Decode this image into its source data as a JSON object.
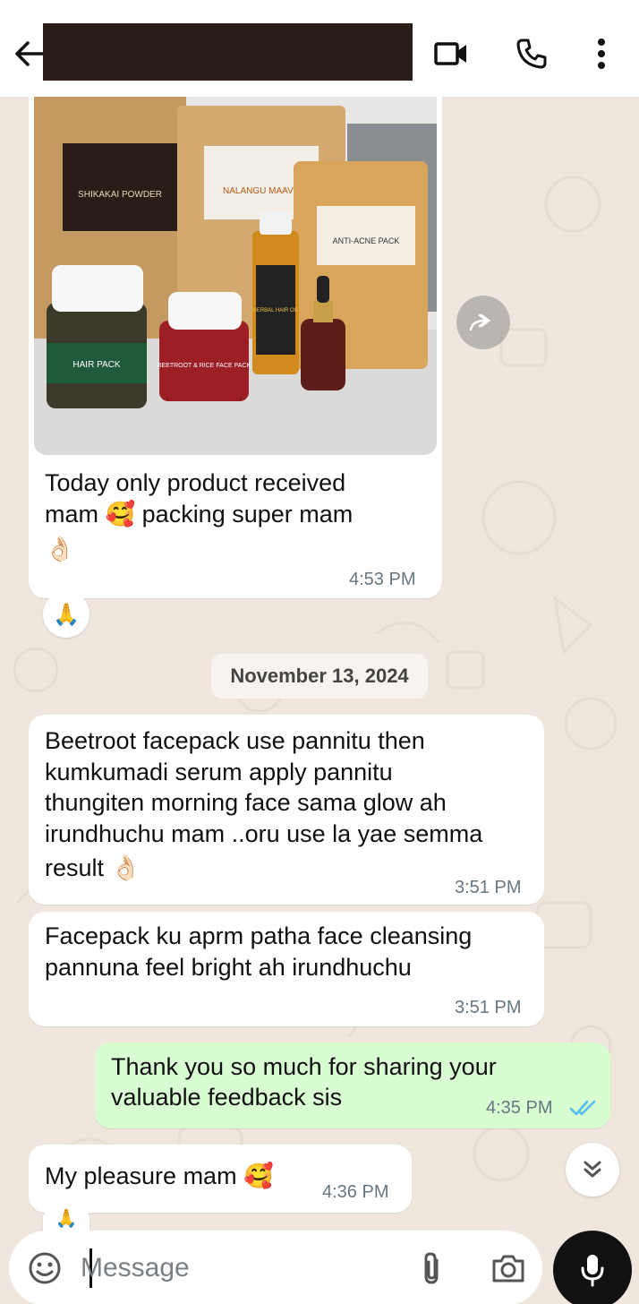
{
  "header": {
    "contact_name": "",
    "back_icon": "arrow-left-icon",
    "video_icon": "video-camera-icon",
    "call_icon": "phone-icon",
    "menu_icon": "more-vertical-icon"
  },
  "messages": [
    {
      "type": "image",
      "direction": "in",
      "product_labels": [
        "SHIKAKAI POWDER",
        "NALANGU MAAVU",
        "ANTI-ACNE PACK",
        "HAIR PACK",
        "BEETROOT & RICE FACE PACK",
        "HERBAL HAIR OIL"
      ],
      "text_line1": "Today only product received",
      "text_line2_a": "mam",
      "emoji1": "🥰",
      "text_line2_b": "packing super mam",
      "emoji2": "👌🏻",
      "time": "4:53 PM",
      "reaction": "🙏"
    },
    {
      "type": "date",
      "label": "November 13, 2024"
    },
    {
      "type": "text",
      "direction": "in",
      "lines": [
        "Beetroot facepack use pannitu then",
        "kumkumadi serum apply pannitu",
        "thungiten morning face sama glow ah",
        "irundhuchu mam ..oru use la yae semma"
      ],
      "last_line": "result",
      "emoji": "👌🏻",
      "time": "3:51 PM"
    },
    {
      "type": "text",
      "direction": "in",
      "lines": [
        "Facepack ku aprm patha face cleansing",
        "pannuna feel bright ah irundhuchu"
      ],
      "time": "3:51 PM"
    },
    {
      "type": "text",
      "direction": "out",
      "lines": [
        "Thank you so much for sharing your",
        "valuable feedback sis"
      ],
      "time": "4:35 PM",
      "status": "read"
    },
    {
      "type": "text",
      "direction": "in",
      "text": "My pleasure mam",
      "emoji": "🥰",
      "time": "4:36 PM",
      "reaction": "🙏"
    }
  ],
  "input": {
    "placeholder": "Message",
    "emoji_icon": "smiley-icon",
    "attach_icon": "paperclip-icon",
    "camera_icon": "camera-icon",
    "mic_icon": "microphone-icon"
  },
  "colors": {
    "header_bg": "#ffffff",
    "chat_bg": "#efe7de",
    "incoming_bubble": "#ffffff",
    "outgoing_bubble": "#d9fdd3",
    "read_ticks": "#53bdeb",
    "mic_button": "#111111"
  }
}
